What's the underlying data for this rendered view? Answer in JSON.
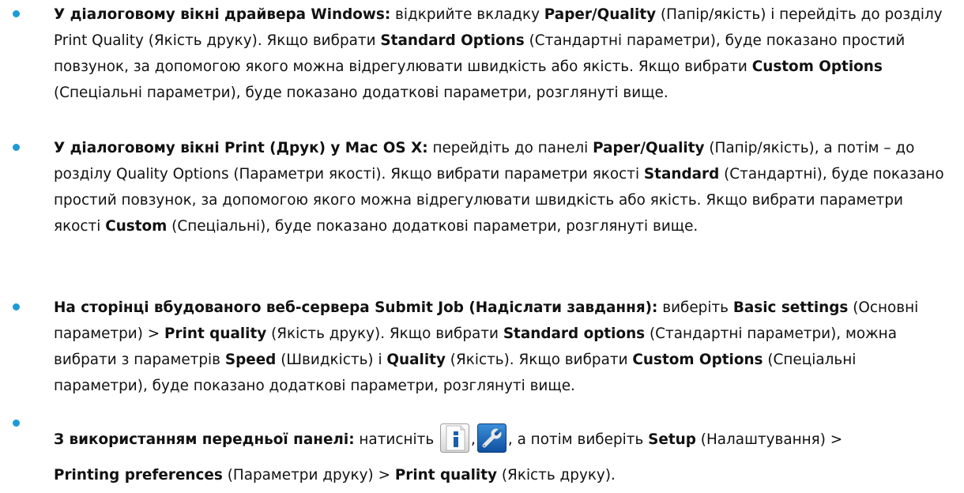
{
  "bullet_color": "#1e9ad6",
  "items": [
    {
      "intro": "У діалоговому вікні драйвера Windows:",
      "t1": " відкрийте вкладку ",
      "b1": "Paper/Quality",
      "t2": " (Папір/якість) і перейдіть до розділу Print Quality (Якість друку). Якщо вибрати ",
      "b2": "Standard Options",
      "t3": " (Стандартні параметри), буде показано простий повзунок, за допомогою якого можна відрегулювати швидкість або якість. Якщо вибрати ",
      "b3": "Custom Options",
      "t4": " (Спеціальні параметри), буде показано додаткові параметри, розглянуті вище."
    },
    {
      "intro": "У діалоговому вікні Print (Друк) у Mac OS X:",
      "t1": " перейдіть до панелі ",
      "b1": "Paper/Quality",
      "t2": " (Папір/якість), а потім – до розділу Quality Options (Параметри якості). Якщо вибрати параметри якості ",
      "b2": "Standard",
      "t3": " (Стандартні), буде показано простий повзунок, за допомогою якого можна відрегулювати швидкість або якість. Якщо вибрати параметри якості ",
      "b3": "Custom",
      "t4": " (Спеціальні), буде показано додаткові параметри, розглянуті вище."
    },
    {
      "intro": "На сторінці вбудованого веб-сервера Submit Job (Надіслати завдання):",
      "t1": " виберіть ",
      "b1": "Basic settings",
      "t2": " (Основні параметри) > ",
      "b2": "Print quality",
      "t3": " (Якість друку). Якщо вибрати ",
      "b3": "Standard options",
      "t4": " (Стандартні параметри), можна вибрати з параметрів ",
      "b4": "Speed",
      "t5": " (Швидкість) і ",
      "b5": "Quality",
      "t6": " (Якість). Якщо вибрати ",
      "b6": "Custom Options",
      "t7": " (Спеціальні параметри), буде показано додаткові параметри, розглянуті вище."
    },
    {
      "intro": "З використанням передньої панелі:",
      "t1": " натисніть ",
      "icon1": "info-icon",
      "sep": ",",
      "icon2": "wrench-icon",
      "t2": ", а потім виберіть ",
      "b1": "Setup",
      "t3": " (Налаштування) > ",
      "b2": "Printing preferences",
      "t4": " (Параметри друку) > ",
      "b3": "Print quality",
      "t5": " (Якість друку)."
    }
  ]
}
